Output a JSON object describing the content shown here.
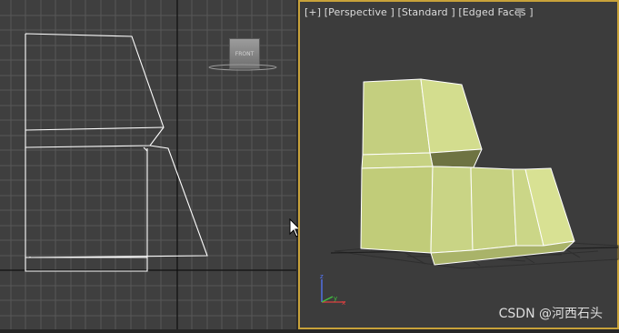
{
  "left_viewport": {
    "viewcube_label": "FRONT"
  },
  "right_viewport": {
    "label": "[+] [Perspective ] [Standard ] [Edged Faces ]",
    "label_parts": [
      "[+]",
      "[Perspective ]",
      "[Standard ]",
      "[Edged Faces ]"
    ],
    "axis_labels": {
      "x": "x",
      "y": "y",
      "z": "z"
    }
  },
  "watermark": "CSDN @河西石头",
  "colors": {
    "grid_bg": "#3f3f3f",
    "grid_line": "#5a5a5a",
    "wire": "#ffffff",
    "active_border": "#c8a23a",
    "mesh_light": "#d2dc8c",
    "mesh_mid": "#c1cd7a",
    "mesh_dark": "#6f7440"
  },
  "icons": [
    "filter-icon",
    "mouse-cursor-icon",
    "axis-gizmo-icon"
  ]
}
